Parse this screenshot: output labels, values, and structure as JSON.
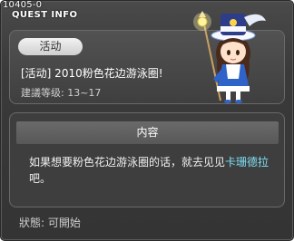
{
  "window": {
    "id_label": "10405-0",
    "title": "QUEST INFO",
    "close_glyph": "×"
  },
  "quest": {
    "badge": "活动",
    "title": "[活动] 2010粉色花边游泳圈!",
    "recommended_level": "建議等级: 13~17"
  },
  "content": {
    "header": "内容",
    "text_before": "如果想要粉色花边游泳圈的话，就去见见",
    "npc_name": "卡珊德拉",
    "text_after": "吧。"
  },
  "status": {
    "label": "狀態: 可開始"
  },
  "icons": {
    "npc_portrait": "npc-cassandra-icon",
    "close": "close-icon"
  },
  "colors": {
    "window_bg": "#3a3a3a",
    "npc_link": "#7fe0f6"
  }
}
